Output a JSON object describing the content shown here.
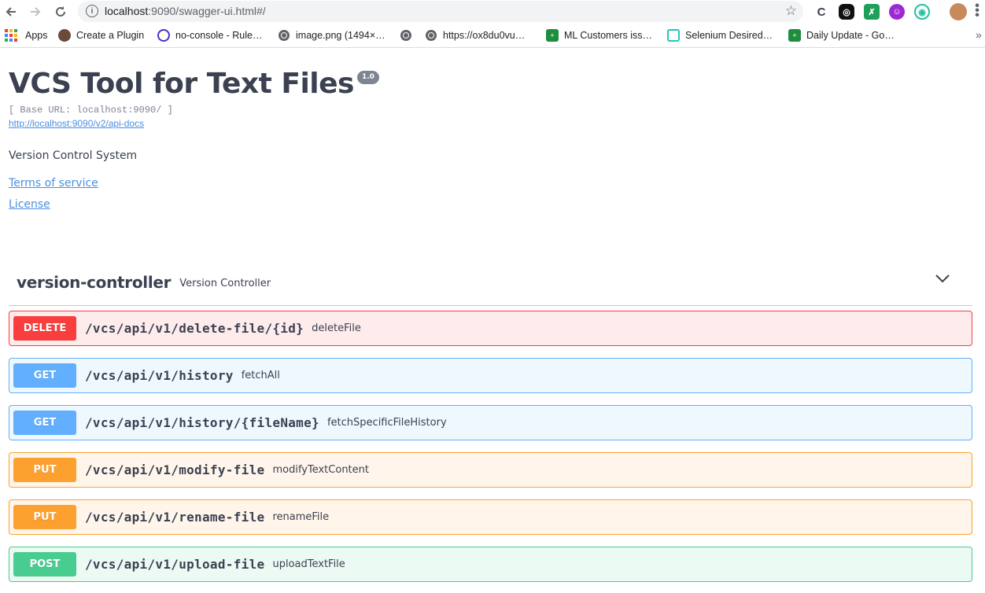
{
  "browser": {
    "url_host": "localhost",
    "url_rest": ":9090/swagger-ui.html#/",
    "extensions": [
      "C",
      "◎",
      "✗",
      "☺",
      "◉"
    ],
    "bookmarks": [
      {
        "label": "Apps",
        "icon": "apps-grid-icon"
      },
      {
        "label": "Create a Plugin",
        "icon": "plugin-favicon-icon"
      },
      {
        "label": "no-console - Rule…",
        "icon": "eslint-favicon-icon"
      },
      {
        "label": "image.png (1494×…",
        "icon": "globe-icon"
      },
      {
        "label": "",
        "icon": "globe-icon"
      },
      {
        "label": "https://ox8du0vu…",
        "icon": "globe-icon"
      },
      {
        "label": "ML Customers iss…",
        "icon": "sheets-favicon-icon"
      },
      {
        "label": "Selenium Desired…",
        "icon": "selenium-favicon-icon"
      },
      {
        "label": "Daily Update - Go…",
        "icon": "sheets-favicon-icon"
      }
    ],
    "bookmarks_overflow": "»"
  },
  "info": {
    "title": "VCS Tool for Text Files",
    "version": "1.0",
    "base_url": "[ Base URL: localhost:9090/ ]",
    "api_docs_link": "http://localhost:9090/v2/api-docs",
    "description": "Version Control System",
    "terms_of_service": "Terms of service",
    "license": "License"
  },
  "tag": {
    "name": "version-controller",
    "description": "Version Controller",
    "expanded": true
  },
  "operations": [
    {
      "method": "DELETE",
      "path": "/vcs/api/v1/delete-file/{id}",
      "summary": "deleteFile",
      "color": "#f93e3e"
    },
    {
      "method": "GET",
      "path": "/vcs/api/v1/history",
      "summary": "fetchAll",
      "color": "#61affe"
    },
    {
      "method": "GET",
      "path": "/vcs/api/v1/history/{fileName}",
      "summary": "fetchSpecificFileHistory",
      "color": "#61affe"
    },
    {
      "method": "PUT",
      "path": "/vcs/api/v1/modify-file",
      "summary": "modifyTextContent",
      "color": "#fca130"
    },
    {
      "method": "PUT",
      "path": "/vcs/api/v1/rename-file",
      "summary": "renameFile",
      "color": "#fca130"
    },
    {
      "method": "POST",
      "path": "/vcs/api/v1/upload-file",
      "summary": "uploadTextFile",
      "color": "#49cc90"
    }
  ]
}
